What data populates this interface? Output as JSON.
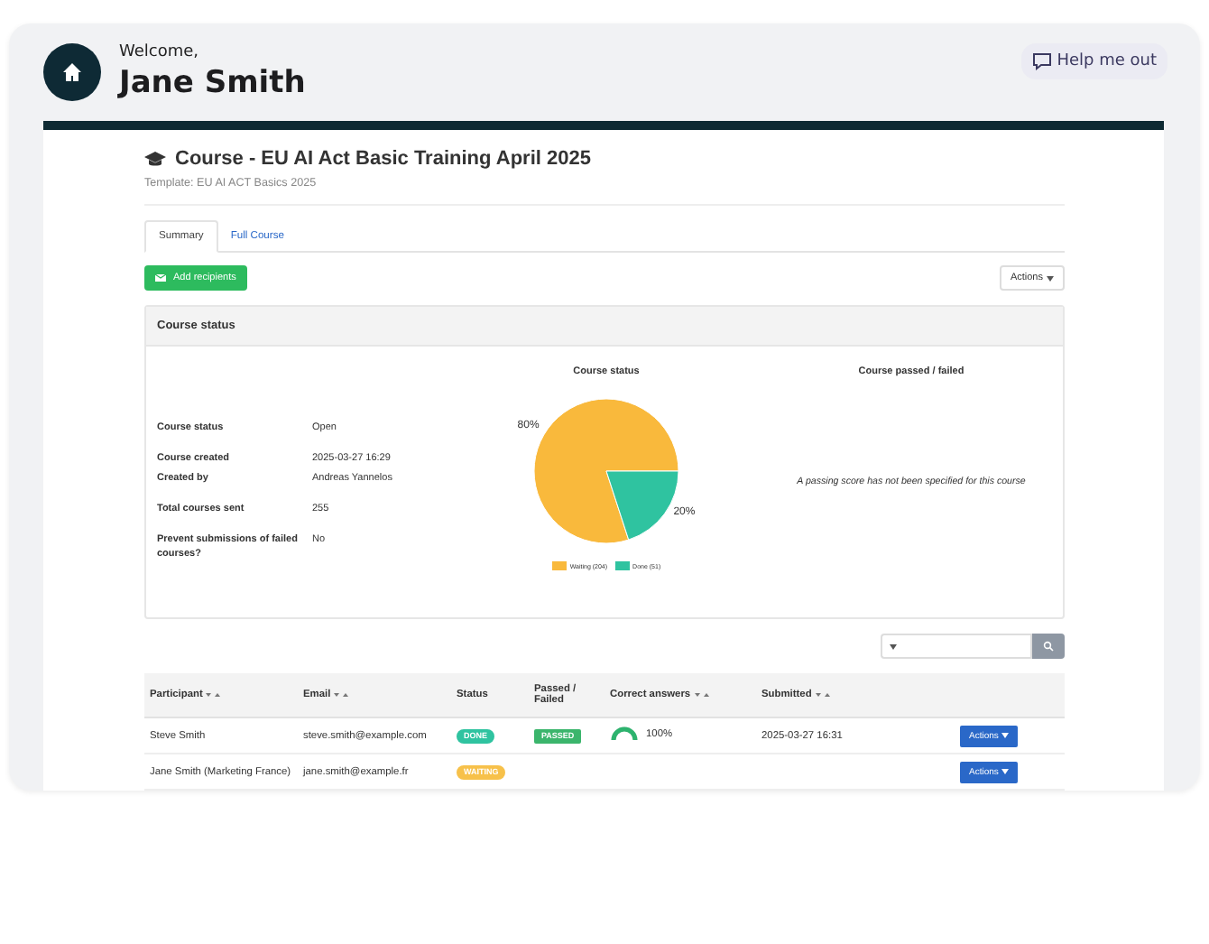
{
  "header": {
    "greeting": "Welcome,",
    "user_name": "Jane Smith",
    "help_button": "Help me out"
  },
  "course": {
    "title": "Course - EU AI Act Basic Training April 2025",
    "template": "Template: EU AI ACT Basics 2025",
    "tabs": [
      {
        "label": "Summary",
        "selected": true
      },
      {
        "label": "Full Course",
        "selected": false
      }
    ],
    "add_button": "Add recipients",
    "actions_button": "Actions",
    "status_card": {
      "title": "Course status",
      "details": [
        [
          {
            "label": "Course status",
            "value": "Open"
          }
        ],
        [
          {
            "label": "Course created",
            "value": "2025-03-27 16:29"
          },
          {
            "label": "Created by",
            "value": "Andreas Yannelos"
          }
        ],
        [
          {
            "label": "Total courses sent",
            "value": "255"
          }
        ],
        [
          {
            "label": "Prevent submissions of failed courses?",
            "value": "No"
          }
        ]
      ],
      "chart_data": {
        "type": "pie",
        "title": "Course status",
        "categories": [
          "Waiting (204)",
          "Done (51)"
        ],
        "values": [
          80,
          20
        ],
        "legend": "bottom",
        "colors": [
          "#f9b93c",
          "#2fc3a0"
        ],
        "value_labels": [
          "80%",
          "20%"
        ]
      },
      "passed_title": "Course passed / failed",
      "passed_note": "A passing score has not been specified for this course"
    }
  },
  "table": {
    "columns": [
      {
        "label": "Participant",
        "sortable": true
      },
      {
        "label": "Email",
        "sortable": true
      },
      {
        "label": "Status",
        "sortable": false
      },
      {
        "label": "Passed / Failed",
        "sortable": false
      },
      {
        "label": "Correct answers",
        "sortable": true
      },
      {
        "label": "Submitted",
        "sortable": true
      }
    ],
    "rows": [
      {
        "participant": "Steve Smith",
        "email": "steve.smith@example.com",
        "status": {
          "text": "DONE",
          "color": "#2fc3a0"
        },
        "result": "PASSED",
        "correct": {
          "reading": "100%"
        },
        "submitted": "2025-03-27 16:31",
        "action": "Actions"
      },
      {
        "participant": "Jane Smith (Marketing France)",
        "email": "jane.smith@example.fr",
        "status": {
          "text": "WAITING",
          "color": "#f7c14a"
        },
        "action": "Actions"
      }
    ]
  }
}
